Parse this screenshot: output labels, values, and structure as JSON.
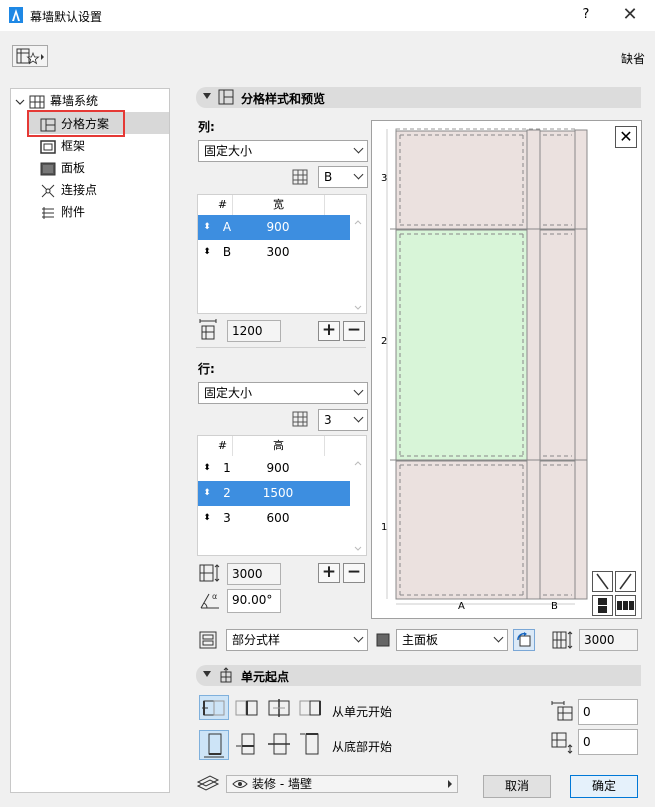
{
  "window": {
    "title": "幕墙默认设置",
    "help_label": "?",
    "close_label": "✕",
    "default_label": "缺省"
  },
  "tree": {
    "root_label": "幕墙系统",
    "items": [
      {
        "label": "分格方案",
        "icon": "scheme-icon"
      },
      {
        "label": "框架",
        "icon": "frame-icon"
      },
      {
        "label": "面板",
        "icon": "panel-icon"
      },
      {
        "label": "连接点",
        "icon": "junction-icon"
      },
      {
        "label": "附件",
        "icon": "accessory-icon"
      }
    ]
  },
  "scheme_section": {
    "title": "分格样式和预览",
    "columns": {
      "label": "列:",
      "mode": "固定大小",
      "count_select": "B",
      "headers": [
        "#",
        "宽"
      ],
      "rows": [
        {
          "id": "A",
          "value": "900"
        },
        {
          "id": "B",
          "value": "300"
        }
      ],
      "selected_index": 0,
      "total": "1200"
    },
    "rows_block": {
      "label": "行:",
      "mode": "固定大小",
      "count_select": "3",
      "headers": [
        "#",
        "高"
      ],
      "rows": [
        {
          "id": "1",
          "value": "900"
        },
        {
          "id": "2",
          "value": "1500"
        },
        {
          "id": "3",
          "value": "600"
        }
      ],
      "selected_index": 1,
      "total": "3000",
      "angle": "90.00°"
    },
    "preview": {
      "row_labels": [
        "3",
        "2",
        "1"
      ],
      "col_labels": [
        "A",
        "B"
      ],
      "close_label": "✕"
    },
    "bottom_controls": {
      "style_select": "部分式样",
      "panel_select": "主面板",
      "height_value": "3000"
    }
  },
  "origin_section": {
    "title": "单元起点",
    "from_cell_label": "从单元开始",
    "from_bottom_label": "从底部开始",
    "x_offset": "0",
    "y_offset": "0"
  },
  "footer": {
    "layer_label": "装修 - 墙壁",
    "cancel_label": "取消",
    "ok_label": "确定"
  },
  "colors": {
    "selection": "#3d8ee0",
    "panel_fill": "#ebe1df",
    "selected_panel_fill": "#d8f5d8",
    "highlight_box": "#e53935"
  }
}
